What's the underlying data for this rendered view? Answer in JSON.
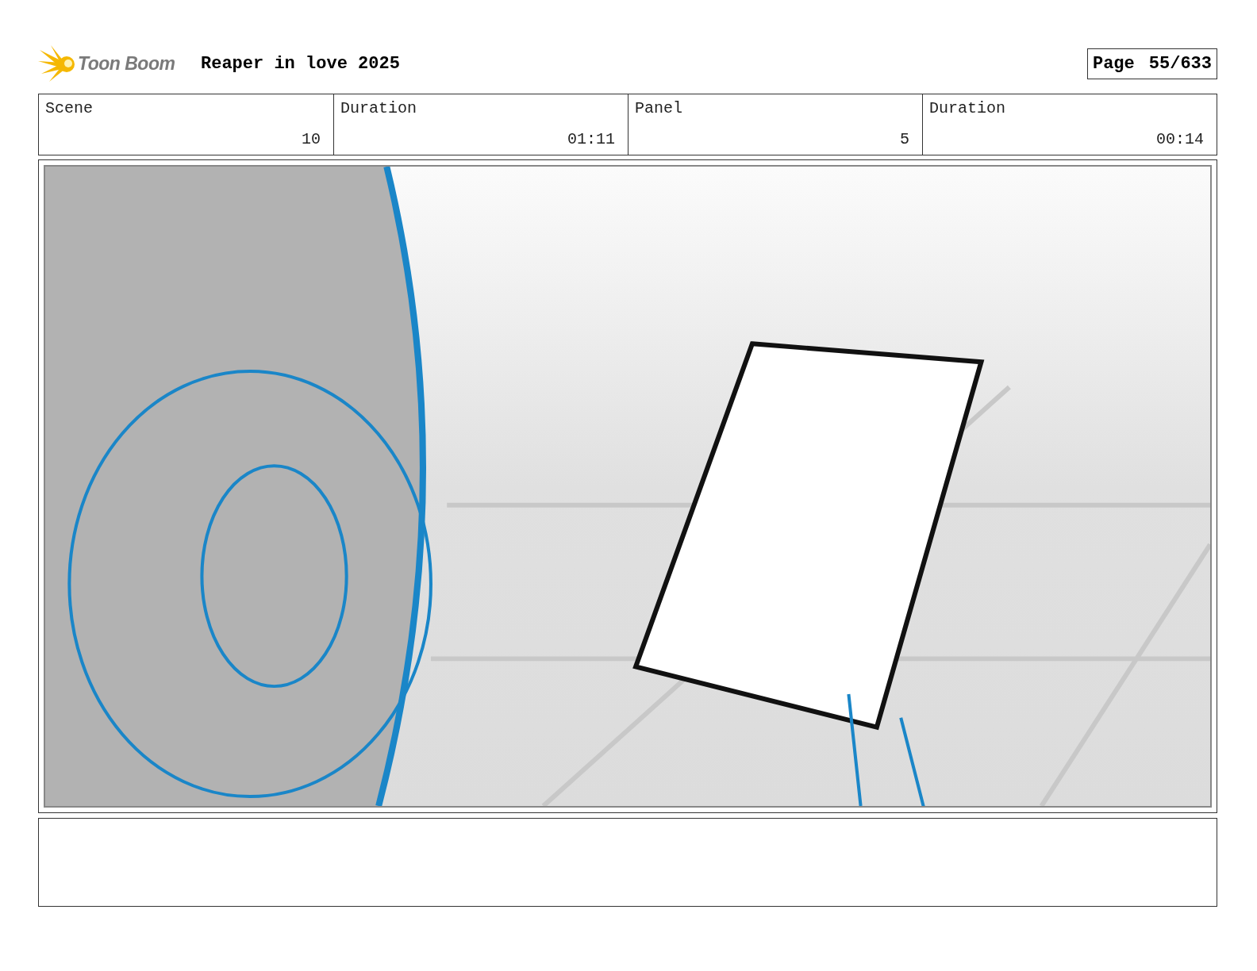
{
  "header": {
    "logo": "Toon Boom",
    "title": "Reaper in love 2025",
    "page_label": "Page",
    "page_number": "55/633"
  },
  "fields": [
    {
      "label": "Scene",
      "value": "10"
    },
    {
      "label": "Duration",
      "value": "01:11"
    },
    {
      "label": "Panel",
      "value": "5"
    },
    {
      "label": "Duration",
      "value": "00:14"
    }
  ]
}
